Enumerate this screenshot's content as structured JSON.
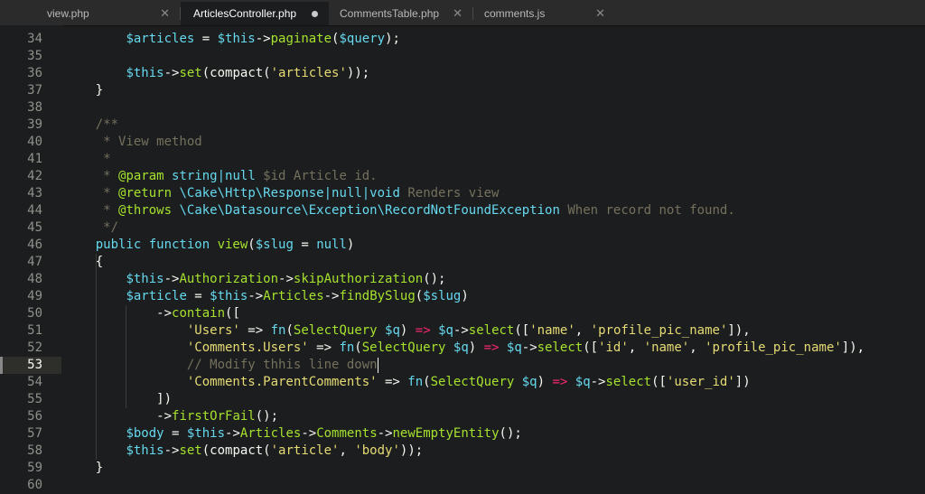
{
  "tabs": [
    {
      "label": "view.php",
      "active": false,
      "modified": false
    },
    {
      "label": "ArticlesController.php",
      "active": true,
      "modified": true
    },
    {
      "label": "CommentsTable.php",
      "active": false,
      "modified": false
    },
    {
      "label": "comments.js",
      "active": false,
      "modified": false
    }
  ],
  "icons": {
    "close": "close-icon",
    "modified": "unsaved-dot-icon"
  },
  "colors": {
    "background": "#1b1d1e",
    "keyword": "#66d9ef",
    "string": "#e6db74",
    "comment": "#75715e",
    "operator": "#f92672",
    "function": "#a6e22e",
    "plain": "#f8f8f2"
  },
  "editor": {
    "current_line": 53,
    "lines": [
      {
        "n": "34",
        "segs": [
          [
            "p",
            "        "
          ],
          [
            "v",
            "$articles"
          ],
          [
            "p",
            " = "
          ],
          [
            "v",
            "$this"
          ],
          [
            "p",
            "->"
          ],
          [
            "f",
            "paginate"
          ],
          [
            "p",
            "("
          ],
          [
            "v",
            "$query"
          ],
          [
            "p",
            ");"
          ]
        ]
      },
      {
        "n": "35",
        "segs": []
      },
      {
        "n": "36",
        "segs": [
          [
            "p",
            "        "
          ],
          [
            "v",
            "$this"
          ],
          [
            "p",
            "->"
          ],
          [
            "f",
            "set"
          ],
          [
            "p",
            "(compact("
          ],
          [
            "s",
            "'articles'"
          ],
          [
            "p",
            "));"
          ]
        ]
      },
      {
        "n": "37",
        "segs": [
          [
            "p",
            "    }"
          ]
        ]
      },
      {
        "n": "38",
        "segs": []
      },
      {
        "n": "39",
        "segs": [
          [
            "c",
            "    /**"
          ]
        ]
      },
      {
        "n": "40",
        "segs": [
          [
            "c",
            "     * View method"
          ]
        ]
      },
      {
        "n": "41",
        "segs": [
          [
            "c",
            "     *"
          ]
        ]
      },
      {
        "n": "42",
        "segs": [
          [
            "c",
            "     * "
          ],
          [
            "f",
            "@param"
          ],
          [
            "c",
            " "
          ],
          [
            "k",
            "string|null"
          ],
          [
            "c",
            " $id Article id."
          ]
        ]
      },
      {
        "n": "43",
        "segs": [
          [
            "c",
            "     * "
          ],
          [
            "f",
            "@return"
          ],
          [
            "c",
            " "
          ],
          [
            "k",
            "\\Cake\\Http\\Response|null|void"
          ],
          [
            "c",
            " Renders view"
          ]
        ]
      },
      {
        "n": "44",
        "segs": [
          [
            "c",
            "     * "
          ],
          [
            "f",
            "@throws"
          ],
          [
            "c",
            " "
          ],
          [
            "k",
            "\\Cake\\Datasource\\Exception\\RecordNotFoundException"
          ],
          [
            "c",
            " When record not found."
          ]
        ]
      },
      {
        "n": "45",
        "segs": [
          [
            "c",
            "     */"
          ]
        ]
      },
      {
        "n": "46",
        "segs": [
          [
            "p",
            "    "
          ],
          [
            "k",
            "public function "
          ],
          [
            "f",
            "view"
          ],
          [
            "p",
            "("
          ],
          [
            "v",
            "$slug"
          ],
          [
            "p",
            " = "
          ],
          [
            "k",
            "null"
          ],
          [
            "p",
            ")"
          ]
        ]
      },
      {
        "n": "47",
        "segs": [
          [
            "p",
            "    {"
          ]
        ]
      },
      {
        "n": "48",
        "segs": [
          [
            "p",
            "        "
          ],
          [
            "v",
            "$this"
          ],
          [
            "p",
            "->"
          ],
          [
            "f",
            "Authorization"
          ],
          [
            "p",
            "->"
          ],
          [
            "f",
            "skipAuthorization"
          ],
          [
            "p",
            "();"
          ]
        ]
      },
      {
        "n": "49",
        "segs": [
          [
            "p",
            "        "
          ],
          [
            "v",
            "$article"
          ],
          [
            "p",
            " = "
          ],
          [
            "v",
            "$this"
          ],
          [
            "p",
            "->"
          ],
          [
            "f",
            "Articles"
          ],
          [
            "p",
            "->"
          ],
          [
            "f",
            "findBySlug"
          ],
          [
            "p",
            "("
          ],
          [
            "v",
            "$slug"
          ],
          [
            "p",
            ")"
          ]
        ]
      },
      {
        "n": "50",
        "segs": [
          [
            "p",
            "            ->"
          ],
          [
            "f",
            "contain"
          ],
          [
            "p",
            "(["
          ]
        ]
      },
      {
        "n": "51",
        "segs": [
          [
            "p",
            "                "
          ],
          [
            "s",
            "'Users'"
          ],
          [
            "p",
            " => "
          ],
          [
            "k",
            "fn"
          ],
          [
            "p",
            "("
          ],
          [
            "f",
            "SelectQuery"
          ],
          [
            "p",
            " "
          ],
          [
            "v",
            "$q"
          ],
          [
            "p",
            ") "
          ],
          [
            "o",
            "=>"
          ],
          [
            "p",
            " "
          ],
          [
            "v",
            "$q"
          ],
          [
            "p",
            "->"
          ],
          [
            "f",
            "select"
          ],
          [
            "p",
            "(["
          ],
          [
            "s",
            "'name'"
          ],
          [
            "p",
            ", "
          ],
          [
            "s",
            "'profile_pic_name'"
          ],
          [
            "p",
            "]),"
          ]
        ]
      },
      {
        "n": "52",
        "segs": [
          [
            "p",
            "                "
          ],
          [
            "s",
            "'Comments.Users'"
          ],
          [
            "p",
            " => "
          ],
          [
            "k",
            "fn"
          ],
          [
            "p",
            "("
          ],
          [
            "f",
            "SelectQuery"
          ],
          [
            "p",
            " "
          ],
          [
            "v",
            "$q"
          ],
          [
            "p",
            ") "
          ],
          [
            "o",
            "=>"
          ],
          [
            "p",
            " "
          ],
          [
            "v",
            "$q"
          ],
          [
            "p",
            "->"
          ],
          [
            "f",
            "select"
          ],
          [
            "p",
            "(["
          ],
          [
            "s",
            "'id'"
          ],
          [
            "p",
            ", "
          ],
          [
            "s",
            "'name'"
          ],
          [
            "p",
            ", "
          ],
          [
            "s",
            "'profile_pic_name'"
          ],
          [
            "p",
            "]),"
          ]
        ]
      },
      {
        "n": "53",
        "segs": [
          [
            "p",
            "                "
          ],
          [
            "c",
            "// Modify thhis line down"
          ]
        ]
      },
      {
        "n": "54",
        "segs": [
          [
            "p",
            "                "
          ],
          [
            "s",
            "'Comments.ParentComments'"
          ],
          [
            "p",
            " => "
          ],
          [
            "k",
            "fn"
          ],
          [
            "p",
            "("
          ],
          [
            "f",
            "SelectQuery"
          ],
          [
            "p",
            " "
          ],
          [
            "v",
            "$q"
          ],
          [
            "p",
            ") "
          ],
          [
            "o",
            "=>"
          ],
          [
            "p",
            " "
          ],
          [
            "v",
            "$q"
          ],
          [
            "p",
            "->"
          ],
          [
            "f",
            "select"
          ],
          [
            "p",
            "(["
          ],
          [
            "s",
            "'user_id'"
          ],
          [
            "p",
            "])"
          ]
        ]
      },
      {
        "n": "55",
        "segs": [
          [
            "p",
            "            ])"
          ]
        ]
      },
      {
        "n": "56",
        "segs": [
          [
            "p",
            "            ->"
          ],
          [
            "f",
            "firstOrFail"
          ],
          [
            "p",
            "();"
          ]
        ]
      },
      {
        "n": "57",
        "segs": [
          [
            "p",
            "        "
          ],
          [
            "v",
            "$body"
          ],
          [
            "p",
            " = "
          ],
          [
            "v",
            "$this"
          ],
          [
            "p",
            "->"
          ],
          [
            "f",
            "Articles"
          ],
          [
            "p",
            "->"
          ],
          [
            "f",
            "Comments"
          ],
          [
            "p",
            "->"
          ],
          [
            "f",
            "newEmptyEntity"
          ],
          [
            "p",
            "();"
          ]
        ]
      },
      {
        "n": "58",
        "segs": [
          [
            "p",
            "        "
          ],
          [
            "v",
            "$this"
          ],
          [
            "p",
            "->"
          ],
          [
            "f",
            "set"
          ],
          [
            "p",
            "(compact("
          ],
          [
            "s",
            "'article'"
          ],
          [
            "p",
            ", "
          ],
          [
            "s",
            "'body'"
          ],
          [
            "p",
            "));"
          ]
        ]
      },
      {
        "n": "59",
        "segs": [
          [
            "p",
            "    }"
          ]
        ]
      },
      {
        "n": "60",
        "segs": []
      }
    ]
  }
}
